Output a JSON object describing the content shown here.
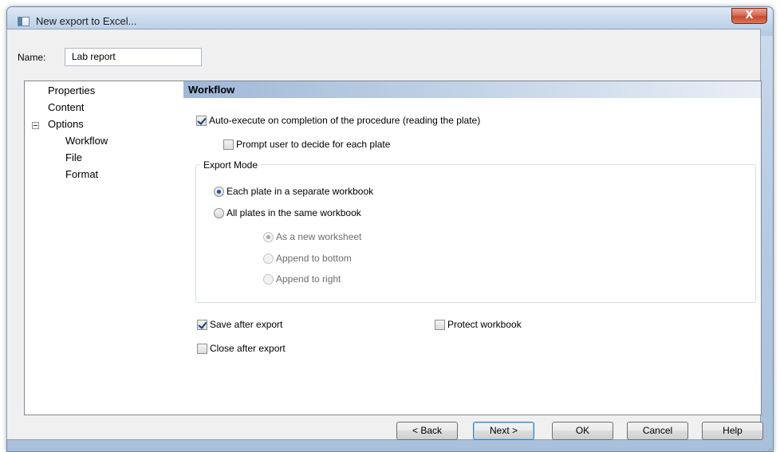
{
  "window": {
    "title": "New export to Excel...",
    "close_label": "X"
  },
  "name_field": {
    "label": "Name:",
    "value": "Lab report"
  },
  "tree": {
    "items": [
      {
        "label": "Properties"
      },
      {
        "label": "Content"
      },
      {
        "label": "Options",
        "expanded": true
      },
      {
        "label": "Workflow",
        "selected": true
      },
      {
        "label": "File"
      },
      {
        "label": "Format"
      }
    ]
  },
  "panel": {
    "header": "Workflow",
    "auto_execute": {
      "label": "Auto-execute on completion of the procedure (reading the plate)",
      "checked": true
    },
    "prompt_user": {
      "label": "Prompt user to decide for each plate",
      "checked": false
    },
    "export_mode": {
      "title": "Export Mode",
      "options": [
        {
          "label": "Each plate in a separate workbook",
          "selected": true
        },
        {
          "label": "All plates in the same workbook",
          "selected": false
        }
      ],
      "sub_options": [
        {
          "label": "As a new worksheet",
          "selected": true,
          "disabled": true
        },
        {
          "label": "Append to bottom",
          "selected": false,
          "disabled": true
        },
        {
          "label": "Append to right",
          "selected": false,
          "disabled": true
        }
      ]
    },
    "save_after_export": {
      "label": "Save after export",
      "checked": true
    },
    "protect_workbook": {
      "label": "Protect workbook",
      "checked": false
    },
    "close_after_export": {
      "label": "Close after export",
      "checked": false
    }
  },
  "buttons": {
    "back": "< Back",
    "next": "Next >",
    "ok": "OK",
    "cancel": "Cancel",
    "help": "Help"
  },
  "colors": {
    "header_gradient_start": "#9fb8d8",
    "close_button": "#c44a2f",
    "radio_selected": "#1f4f9c"
  }
}
